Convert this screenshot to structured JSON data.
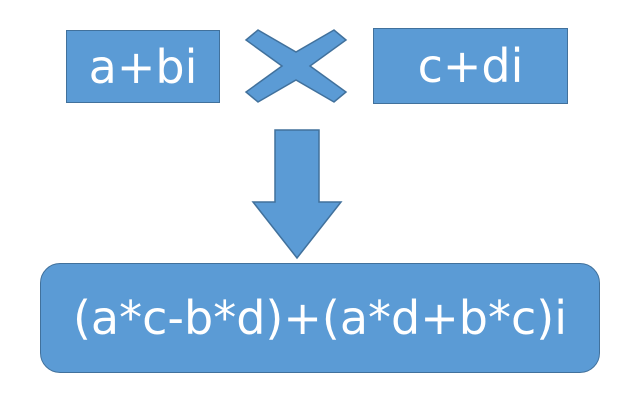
{
  "operand_left": "a+bi",
  "operand_right": "c+di",
  "result": "(a*c-b*d)+(a*d+b*c)i",
  "icons": {
    "operator": "multiply-icon",
    "flow": "arrow-down-icon"
  },
  "colors": {
    "fill": "#5b9bd5",
    "stroke": "#41719c",
    "text": "#ffffff"
  }
}
